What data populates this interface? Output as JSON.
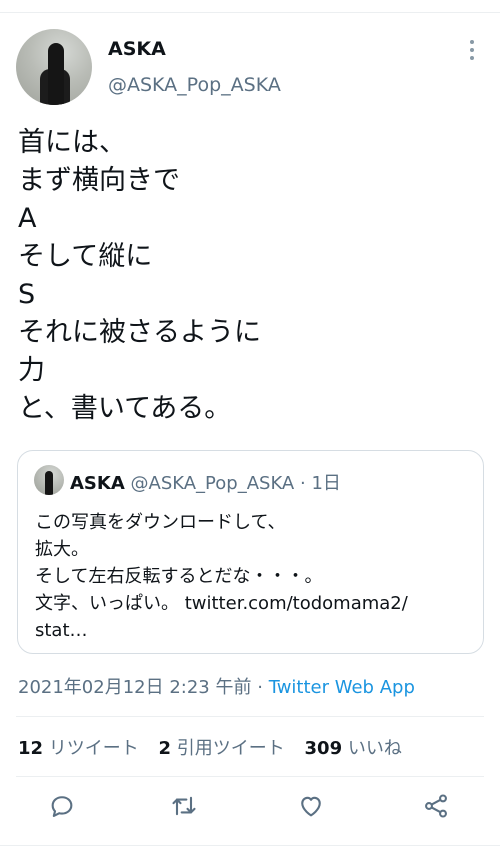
{
  "tweet": {
    "author_name": "ASKA",
    "author_handle": "@ASKA_Pop_ASKA",
    "text": "首には、\nまず横向きで\nA\nそして縦に\nS\nそれに被さるように\n力\nと、書いてある。"
  },
  "quote": {
    "author_name": "ASKA",
    "author_handle": "@ASKA_Pop_ASKA",
    "separator": "·",
    "time": "1日",
    "text": "この写真をダウンロードして、\n拡大。\nそして左右反転するとだな・・・。\n文字、いっぱい。 twitter.com/todomama2/\nstat…"
  },
  "meta": {
    "timestamp": "2021年02月12日 2:23 午前",
    "separator": "·",
    "source": "Twitter Web App"
  },
  "stats": {
    "retweets_count": "12",
    "retweets_label": "リツイート",
    "quotes_count": "2",
    "quotes_label": "引用ツイート",
    "likes_count": "309",
    "likes_label": "いいね"
  },
  "colors": {
    "text": "#0f1419",
    "secondary": "#5b7083",
    "link": "#1b95e0",
    "divider": "#eceff1"
  },
  "icons": {
    "more": "more-vertical-icon",
    "reply": "reply-icon",
    "retweet": "retweet-icon",
    "like": "heart-icon",
    "share": "share-icon"
  }
}
